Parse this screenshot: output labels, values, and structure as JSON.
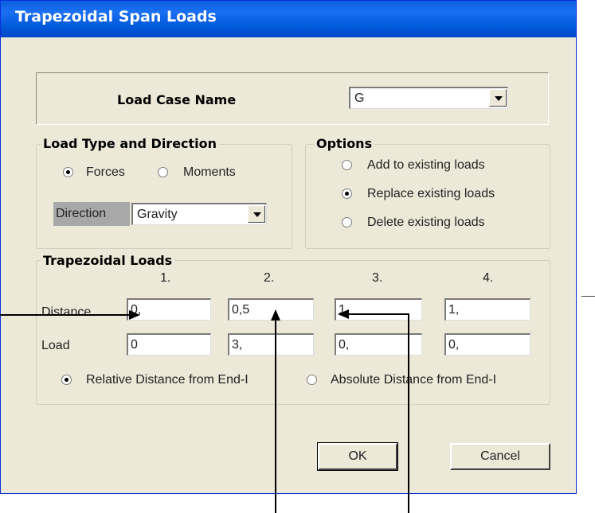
{
  "title": "Trapezoidal Span Loads",
  "load_case": {
    "label": "Load Case Name",
    "value": "G"
  },
  "load_type": {
    "legend": "Load Type and Direction",
    "forces": "Forces",
    "moments": "Moments",
    "selected": "Forces",
    "direction_label": "Direction",
    "direction_value": "Gravity"
  },
  "options": {
    "legend": "Options",
    "items": [
      "Add to existing loads",
      "Replace existing loads",
      "Delete existing loads"
    ],
    "selected": "Replace existing loads"
  },
  "trap": {
    "legend": "Trapezoidal Loads",
    "columns": [
      "1.",
      "2.",
      "3.",
      "4."
    ],
    "distance_label": "Distance",
    "load_label": "Load",
    "distance": [
      "0,",
      "0,5",
      "1",
      "1,"
    ],
    "load": [
      "0",
      "3,",
      "0,",
      "0,"
    ],
    "relative": "Relative Distance from End-I",
    "absolute": "Absolute Distance from End-I",
    "selected": "Relative Distance from End-I"
  },
  "buttons": {
    "ok": "OK",
    "cancel": "Cancel"
  }
}
